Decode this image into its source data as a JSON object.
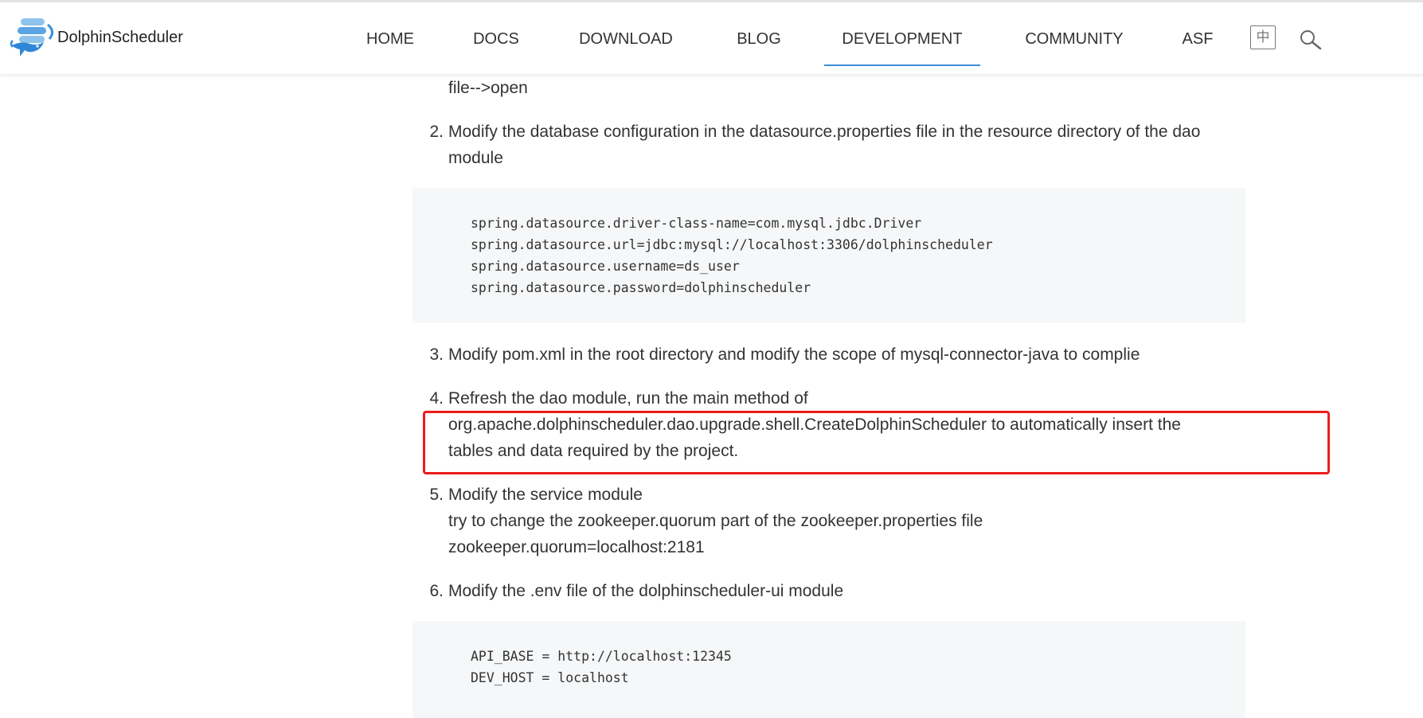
{
  "header": {
    "logo_text": "DolphinScheduler",
    "nav": [
      {
        "label": "HOME",
        "active": false
      },
      {
        "label": "DOCS",
        "active": false
      },
      {
        "label": "DOWNLOAD",
        "active": false
      },
      {
        "label": "BLOG",
        "active": false
      },
      {
        "label": "DEVELOPMENT",
        "active": true
      },
      {
        "label": "COMMUNITY",
        "active": false
      },
      {
        "label": "ASF",
        "active": false
      }
    ],
    "lang_label": "中",
    "search_icon": "search-icon",
    "accent_color": "#3b8fd9"
  },
  "content": {
    "step1_tail": "file-->open",
    "step2": {
      "num": "2.",
      "line1": "Modify the database configuration in the datasource.properties file in the resource directory of the dao",
      "line2": "module"
    },
    "code1": [
      "spring.datasource.driver-class-name=com.mysql.jdbc.Driver",
      "spring.datasource.url=jdbc:mysql://localhost:3306/dolphinscheduler",
      "spring.datasource.username=ds_user",
      "spring.datasource.password=dolphinscheduler"
    ],
    "step3": {
      "num": "3.",
      "line1": "Modify pom.xml in the root directory and modify the scope of mysql-connector-java to complie"
    },
    "step4": {
      "num": "4.",
      "line1": "Refresh the dao module, run the main method of",
      "line2": "org.apache.dolphinscheduler.dao.upgrade.shell.CreateDolphinScheduler to automatically insert the",
      "line3": "tables and data required by the project."
    },
    "step5": {
      "num": "5.",
      "line1": "Modify the service module",
      "line2": "try to change the zookeeper.quorum part of the zookeeper.properties file",
      "line3": "zookeeper.quorum=localhost:2181"
    },
    "step6": {
      "num": "6.",
      "line1": "Modify the .env file of the dolphinscheduler-ui module"
    },
    "code2": [
      "API_BASE = http://localhost:12345",
      "DEV_HOST = localhost"
    ],
    "highlight_color": "#ee1c1c"
  }
}
